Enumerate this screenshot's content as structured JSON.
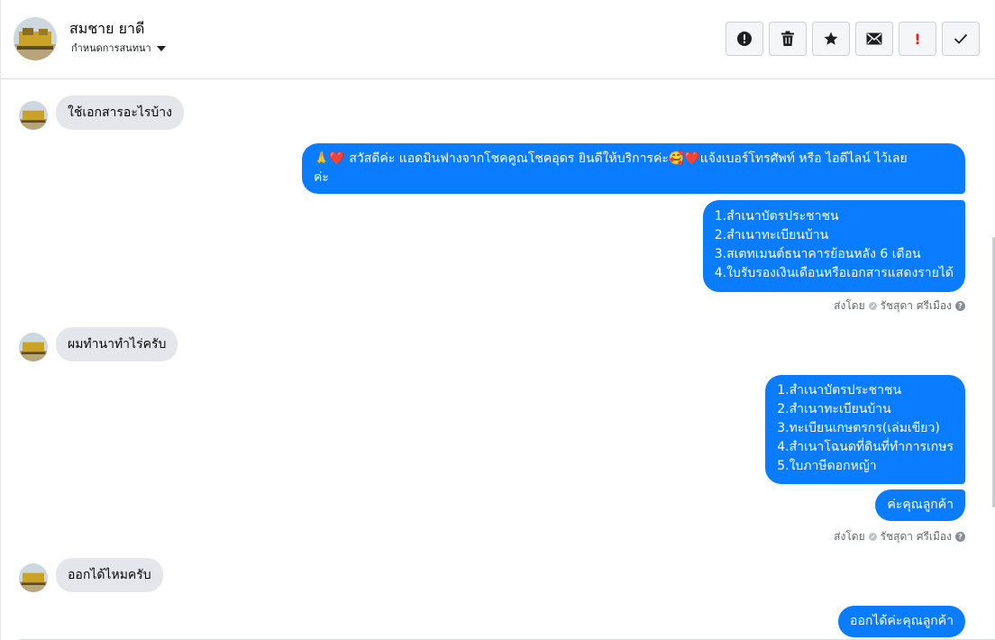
{
  "header": {
    "contact_name": "สมชาย ยาดี",
    "assign_label": "กำหนดการสนทนา",
    "toolbar": [
      {
        "name": "alert-button",
        "icon": "alert-circle-icon"
      },
      {
        "name": "delete-button",
        "icon": "trash-icon"
      },
      {
        "name": "star-button",
        "icon": "star-icon"
      },
      {
        "name": "mark-unread-button",
        "icon": "envelope-icon"
      },
      {
        "name": "important-button",
        "icon": "exclamation-icon",
        "glyph": "!"
      },
      {
        "name": "done-button",
        "icon": "check-icon"
      }
    ]
  },
  "colors": {
    "outgoing_bubble": "#0a7cff",
    "incoming_bubble": "#e4e6eb",
    "important_red": "#e02424"
  },
  "messages": {
    "m1": "ใช้เอกสารอะไรบ้าง",
    "m2_line1": "🙏❤️ สวัสดีค่ะ แอดมินฟางจากโชคคูณโชคอุดร ยินดีให้บริการค่ะ🥰❤️แจ้งเบอร์โทรศัพท์ หรือ ไอดีไลน์  ไว้เลย",
    "m2_line2": "ค่ะ",
    "m3_lines": [
      "1.สำเนาบัตรประชาชน",
      "2.สำเนาทะเบียนบ้าน",
      "3.สเตทเมนต์ธนาคารย้อนหลัง 6 เดือน",
      "4.ใบรับรองเงินเดือนหรือเอกสารแสดงรายได้"
    ],
    "m4": "ผมทำนาทำไร่ครับ",
    "m5_lines": [
      "1.สำเนาบัตรประชาชน",
      "2.สำเนาทะเบียนบ้าน",
      "3.ทะเบียนเกษตรกร(เล่มเขียว)",
      "4.สำเนาโฉนดที่ดินที่ทำการเกษร",
      "5.ใบภาษีดอกหญ้า"
    ],
    "m6": "ค่ะคุณลูกค้า",
    "m7": "ออกได้ไหมครับ",
    "m8": "ออกได้ค่ะคุณลูกค้า"
  },
  "sent_by": {
    "prefix": "ส่งโดย",
    "agent": "รัชสุดา ศรีเมือง"
  }
}
